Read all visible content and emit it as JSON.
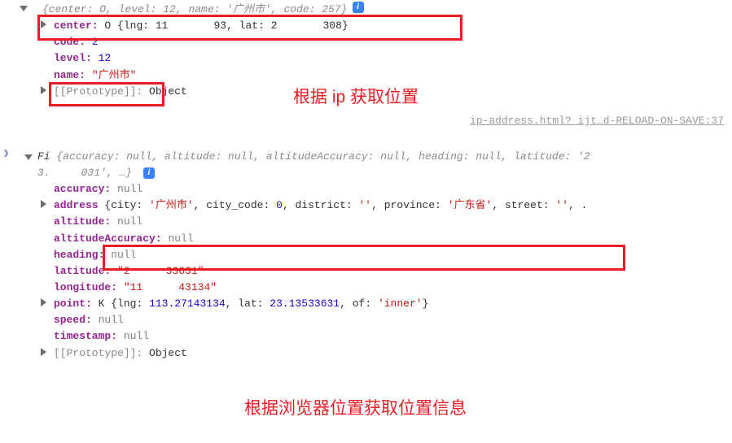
{
  "colors": {
    "highlight": "#ec1c24",
    "key": "#922790",
    "string": "#c41a16",
    "number": "#1c00cf",
    "null": "#808080"
  },
  "obj1": {
    "summary_prefix": "{center: O, level: ",
    "summary_level": "12",
    "summary_mid": ", name: ",
    "summary_name": "'广州市'",
    "summary_mid2": ", code: ",
    "summary_code": "257",
    "summary_suffix": "}",
    "center_label": "center:",
    "center_class": "O",
    "center_open": "{lng: ",
    "center_lng_a": "11",
    "center_lng_b": "93",
    "center_mid": ", lat: ",
    "center_lat_a": "2",
    "center_lat_b": "308",
    "center_close": "}",
    "code_label": "code:",
    "code_val_vis": "2",
    "level_label": "level:",
    "level_val": "12",
    "name_label": "name:",
    "name_val": "\"广州市\"",
    "proto_label": "[[Prototype]]:",
    "proto_val": "Object"
  },
  "annot1": "根据 ip 获取位置",
  "annot2": "根据浏览器位置获取位置信息",
  "top_link": "ip-address.html?_ijt…d-RELOAD-ON-SAVE:37",
  "obj2": {
    "class": "Fi",
    "summary_a": "{accuracy: null, altitude: null, altitudeAccuracy: null, heading: null, latitude: '2",
    "summary_b": "3.",
    "summary_c": "031', …}",
    "accuracy_label": "accuracy:",
    "null_text": "null",
    "address_label": "address",
    "address_open": " {city: ",
    "address_city": "'广州市'",
    "address_m1": ", city_code: ",
    "address_city_code": "0",
    "address_m2": ", district: ",
    "address_district": "''",
    "address_m3": ", province: ",
    "address_province": "'广东省'",
    "address_m4": ", street: ",
    "address_street": "''",
    "address_tail": ", .",
    "altitude_label": "altitude:",
    "altacc_label": "altitudeAccuracy:",
    "heading_label": "heading:",
    "lat_label": "latitude:",
    "lat_a": "\"2",
    "lat_b": "33631\"",
    "lng_label": "longitude:",
    "lng_a": "\"11",
    "lng_b": "43134\"",
    "point_label": "point:",
    "point_class": "K",
    "point_open": "{lng: ",
    "point_lng": "113.27143134",
    "point_m": ", lat: ",
    "point_lat": "23.13533631",
    "point_m2": ", of: ",
    "point_of": "'inner'",
    "point_close": "}",
    "speed_label": "speed:",
    "ts_label": "timestamp:",
    "proto_label": "[[Prototype]]:",
    "proto_val": "Object"
  }
}
